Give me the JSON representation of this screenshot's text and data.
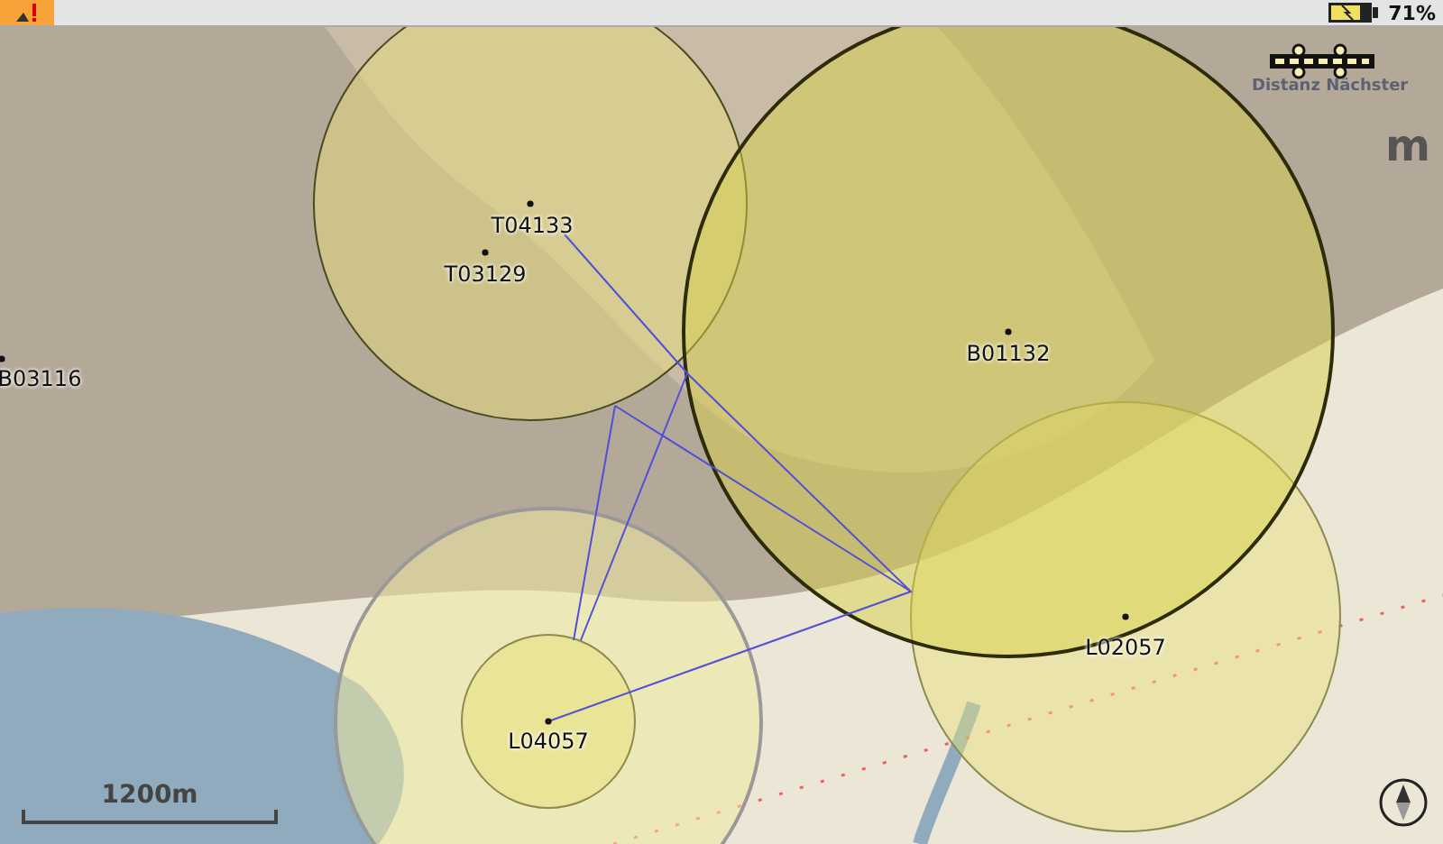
{
  "status_bar": {
    "battery": "71%"
  },
  "map": {
    "waypoints": [
      {
        "label": "T04133"
      },
      {
        "label": "T03129"
      },
      {
        "label": "B03116"
      },
      {
        "label": "B01132"
      },
      {
        "label": "L02057"
      },
      {
        "label": "L04057"
      }
    ],
    "distance_label": "Distanz Nächster",
    "distance_unit": "m",
    "scale": "1200m"
  }
}
